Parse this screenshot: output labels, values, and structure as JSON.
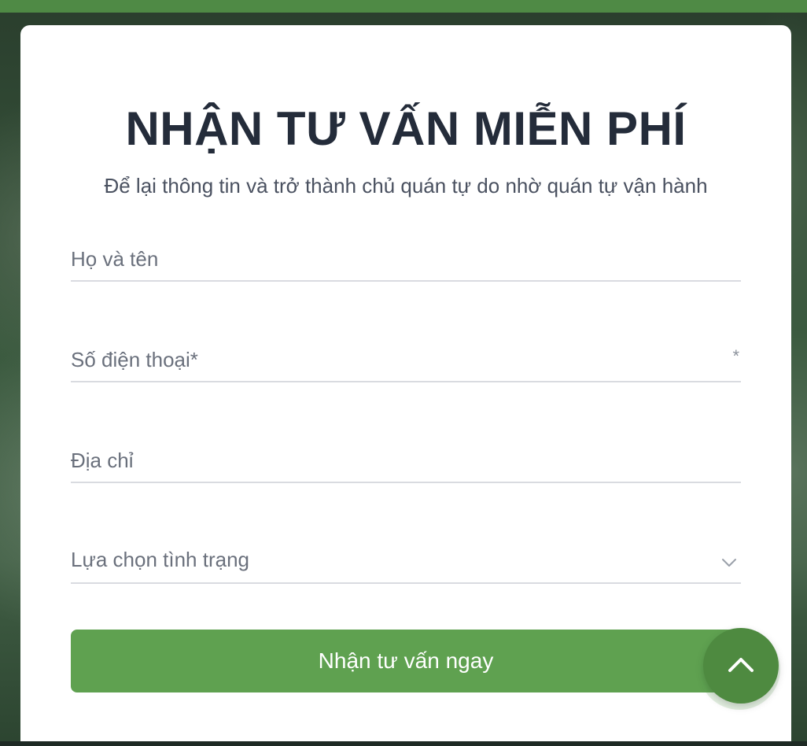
{
  "form": {
    "title": "NHẬN TƯ VẤN MIỄN PHÍ",
    "subtitle": "Để lại thông tin và trở thành chủ quán tự do nhờ quán tự vận hành",
    "name_placeholder": "Họ và tên",
    "phone_placeholder": "Số điện thoại*",
    "phone_required_mark": "*",
    "address_placeholder": "Địa chỉ",
    "status_select_label": "Lựa chọn tình trạng",
    "submit_label": "Nhận tư vấn ngay"
  },
  "icons": {
    "select_chevron": "chevron-down-icon",
    "scroll_top": "chevron-up-icon"
  },
  "colors": {
    "accent": "#5fa150",
    "title": "#242c3a",
    "scroll_button": "#4e8a40",
    "top_bar": "#4f8a45"
  }
}
